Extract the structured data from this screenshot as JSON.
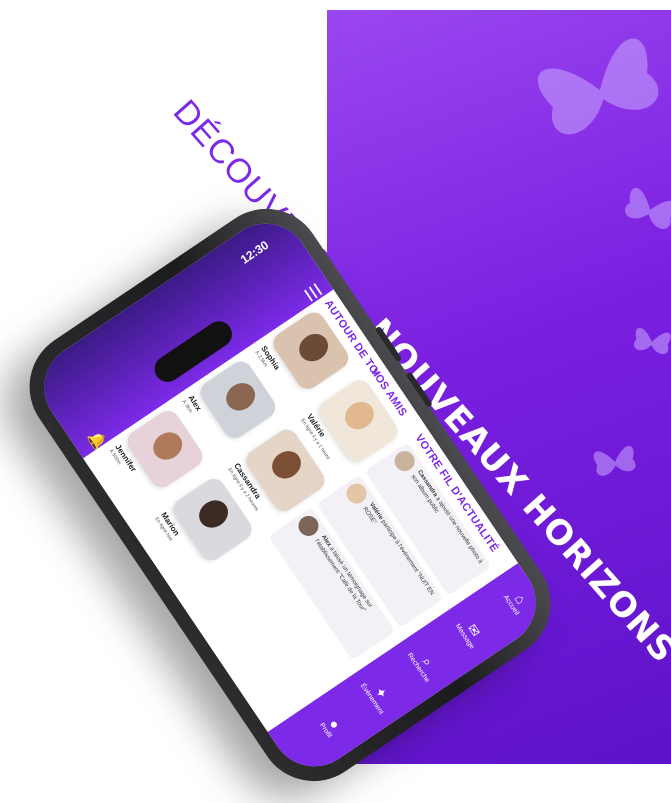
{
  "headline": {
    "light": "DÉCOUVREZ DE ",
    "bold": "NOUVEAUX HORIZONS"
  },
  "status": {
    "time": "12:30"
  },
  "icons": {
    "menu": "☰",
    "bell": "🔔",
    "butterfly": "🦋"
  },
  "sections": {
    "nearby": "AUTOUR DE TOI",
    "friends": "VOS AMIS",
    "feed": "VOTRE FIL D'ACTUALITÉ"
  },
  "nearby": [
    {
      "name": "Sophia",
      "dist": "À 3,5km"
    },
    {
      "name": "Alex",
      "dist": "À 3km"
    },
    {
      "name": "Jennifer",
      "dist": "À 500m"
    }
  ],
  "friends": [
    {
      "name": "Valérie",
      "dist": "En ligne il y a 1 heure"
    },
    {
      "name": "Cassandra",
      "dist": "En ligne il y a 2 heures"
    },
    {
      "name": "Marion",
      "dist": "En ligne hier"
    }
  ],
  "feed": [
    {
      "who": "Cassandra",
      "text": " a ajouté une nouvelle photo à son album public"
    },
    {
      "who": "Valérie",
      "text": " participe à l'événement \"NUIT EN ROSE\""
    },
    {
      "who": "Alex",
      "text": " a laissé un témoignage sur l'établissement \"Café de la Tour\""
    }
  ],
  "nav": [
    {
      "label": "Accueil",
      "icon": "⌂"
    },
    {
      "label": "Message",
      "icon": "✉"
    },
    {
      "label": "Recherche",
      "icon": "⌕"
    },
    {
      "label": "Évènement",
      "icon": "✦"
    },
    {
      "label": "Profil",
      "icon": "●"
    }
  ],
  "colors": {
    "accent": "#7c2ae8",
    "panel": "#7a1fe0"
  }
}
